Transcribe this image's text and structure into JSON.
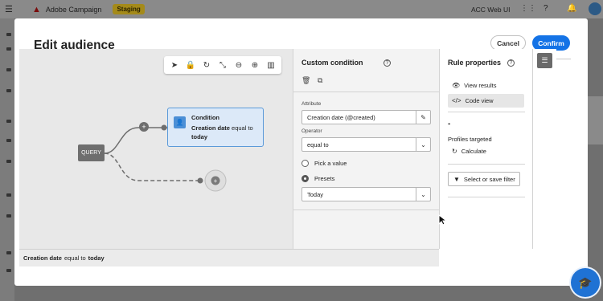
{
  "app": {
    "name": "Adobe Campaign",
    "environment": "Staging",
    "ui_label": "ACC Web UI"
  },
  "modal": {
    "title": "Edit audience",
    "cancel_label": "Cancel",
    "confirm_label": "Confirm"
  },
  "canvas": {
    "toolbar_icons": [
      "pointer-icon",
      "lock-icon",
      "rotate-icon",
      "collapse-icon",
      "zoom-out-icon",
      "zoom-in-icon",
      "map-icon"
    ],
    "query_label": "QUERY",
    "condition_node": {
      "title": "Condition",
      "attribute": "Creation date",
      "operator": "equal to",
      "value": "today"
    },
    "footer": {
      "attribute": "Creation date",
      "operator": "equal to",
      "value": "today"
    }
  },
  "custom_condition": {
    "title": "Custom condition",
    "attribute_label": "Attribute",
    "attribute_value": "Creation date (@created)",
    "operator_label": "Operator",
    "operator_value": "equal to",
    "pick_value_label": "Pick a value",
    "presets_label": "Presets",
    "preset_value": "Today"
  },
  "rule_properties": {
    "title": "Rule properties",
    "view_results": "View results",
    "code_view": "Code view",
    "count": "-",
    "profiles_targeted": "Profiles targeted",
    "calculate": "Calculate",
    "select_save_filter": "Select or save filter"
  }
}
